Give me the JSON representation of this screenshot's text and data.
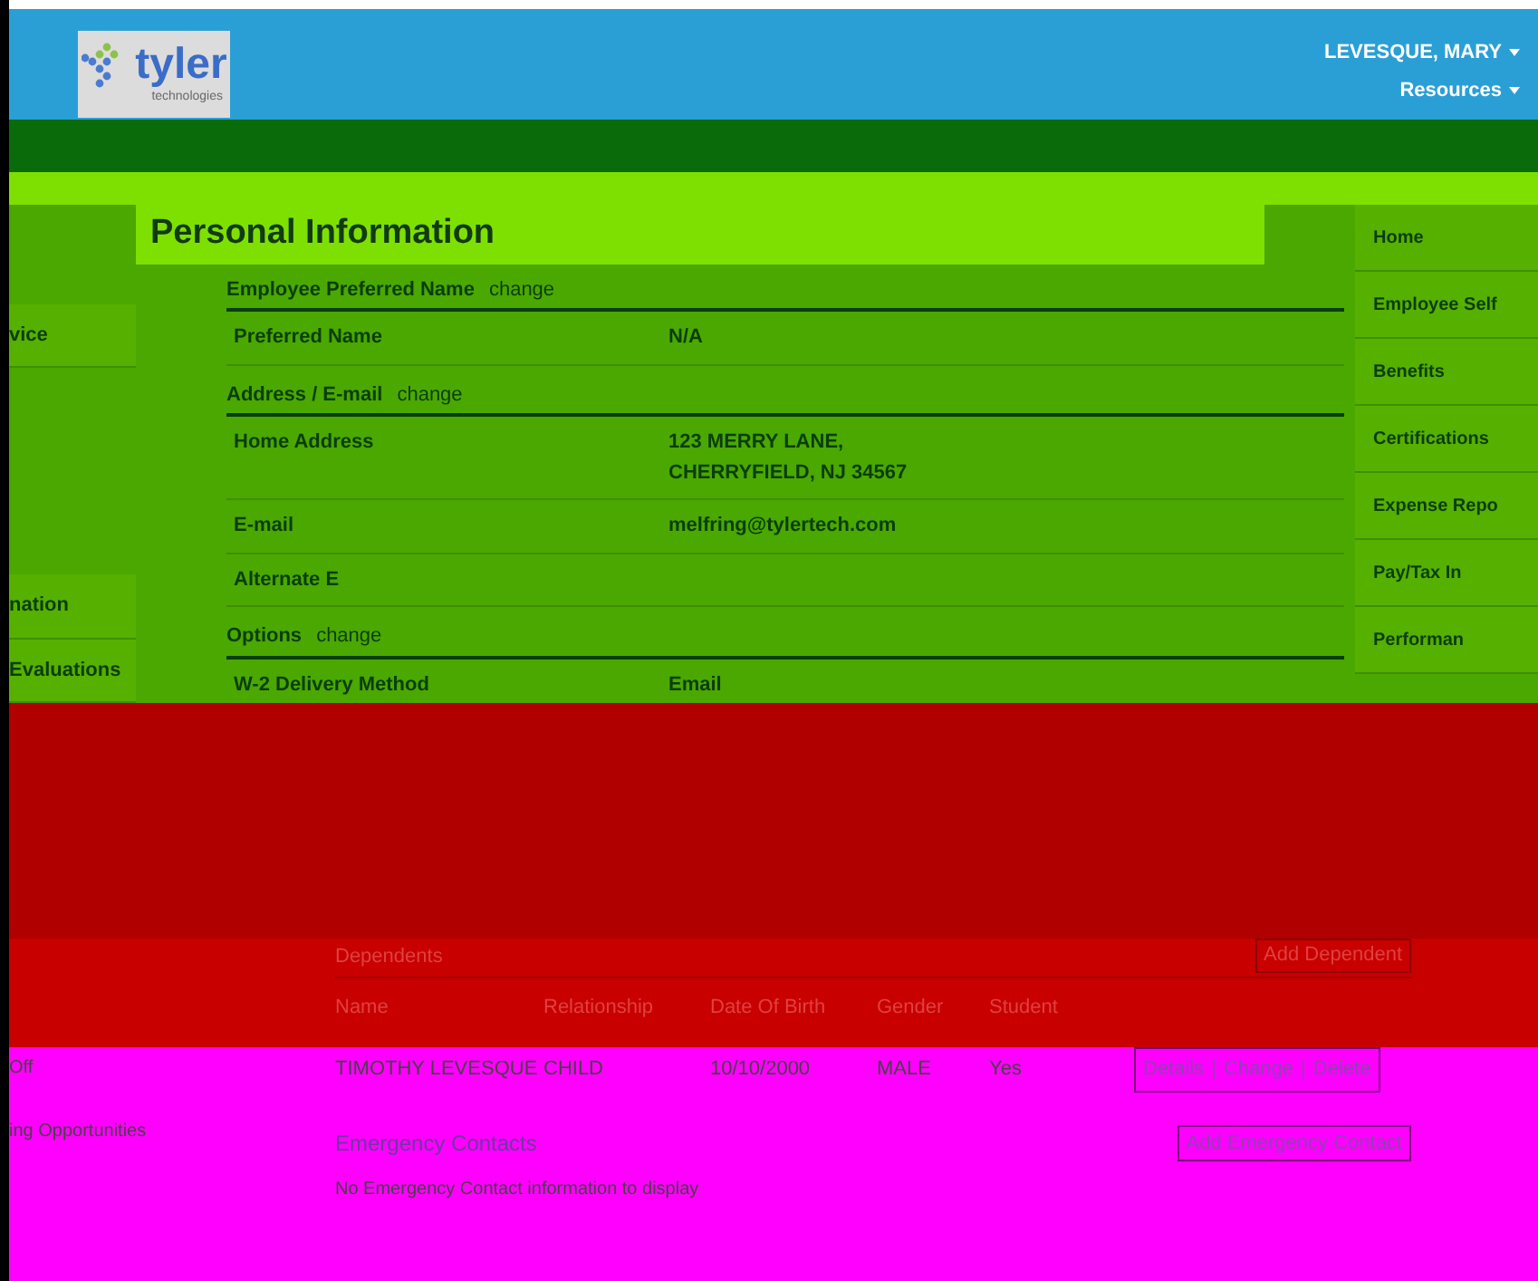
{
  "header": {
    "logo_text": "tyler",
    "logo_subtext": "technologies",
    "user_name": "LEVESQUE, MARY",
    "menu": "Resources"
  },
  "page_title": "Personal Information",
  "left_nav": [
    {
      "label": "vice"
    },
    {
      "label": "nation"
    },
    {
      "label": "Evaluations"
    }
  ],
  "left_nav_lower": [
    {
      "label": "Off"
    },
    {
      "label": "ing Opportunities"
    }
  ],
  "right_nav": [
    {
      "label": "Home"
    },
    {
      "label": "Employee Self"
    },
    {
      "label": "Benefits"
    },
    {
      "label": "Certifications"
    },
    {
      "label": "Expense Repo"
    },
    {
      "label": "Pay/Tax In"
    },
    {
      "label": "Performan"
    }
  ],
  "sections": [
    {
      "title": "Employee Preferred Name",
      "action": "change",
      "fields": [
        {
          "label": "Preferred Name",
          "value": "N/A"
        }
      ]
    },
    {
      "title": "Address / E-mail",
      "action": "change",
      "fields": [
        {
          "label": "Home Address",
          "value": "123 MERRY LANE,\nCHERRYFIELD, NJ 34567"
        },
        {
          "label": "E-mail",
          "value": "melfring@tylertech.com"
        },
        {
          "label": "Alternate E"
        }
      ]
    },
    {
      "title": "Options",
      "action": "change",
      "fields": [
        {
          "label": "W-2 Delivery Method",
          "value": "Email"
        }
      ]
    }
  ],
  "dependents": {
    "title": "Dependents",
    "button": "Add Dependent",
    "columns": [
      "Name",
      "Relationship",
      "Date Of Birth",
      "Gender",
      "Student"
    ],
    "rows": [
      {
        "cells": [
          "TIMOTHY LEVESQUE",
          "CHILD",
          "10/10/2000",
          "MALE",
          "Yes"
        ],
        "actions": [
          "Details",
          "Change",
          "Delete"
        ]
      }
    ],
    "separator": "|"
  },
  "emergency": {
    "title": "Emergency Contacts",
    "button": "Add Emergency Contact",
    "empty": "No Emergency Contact information to display"
  }
}
